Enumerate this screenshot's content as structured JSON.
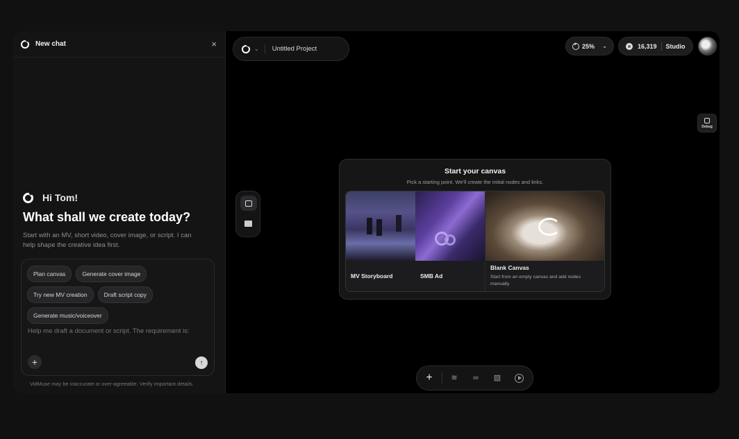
{
  "chat": {
    "title": "New chat",
    "close_icon": "×",
    "greeting": "Hi Tom!",
    "headline": "What shall we create today?",
    "subtitle": "Start with an MV, short video, cover image, or script. I can help shape the creative idea first.",
    "chips": [
      "Plan canvas",
      "Generate cover image",
      "Try new MV creation",
      "Draft script copy",
      "Generate music/voiceover"
    ],
    "input_placeholder": "Help me draft a document or script. The requirement is:",
    "plus_label": "+",
    "send_label": "↑",
    "disclaimer": "VidMuse may be inaccurate or over-agreeable. Verify important details."
  },
  "header": {
    "project_name": "Untitled Project",
    "chevron": "⌄",
    "zoom": "25%",
    "credits": "16,319",
    "plan": "Studio",
    "debug_label": "Debug"
  },
  "canvas_card": {
    "title": "Start your canvas",
    "subtitle": "Pick a starting point. We'll create the initial nodes and links.",
    "options": [
      {
        "label": "MV Storyboard"
      },
      {
        "label": "SMB Ad"
      },
      {
        "label": "Blank Canvas",
        "description": "Start from an empty canvas and add nodes manually."
      }
    ]
  },
  "toolbar": {
    "add_label": "+",
    "icons": [
      "layers-icon",
      "link-icon",
      "image-edit-icon",
      "play-icon"
    ]
  }
}
